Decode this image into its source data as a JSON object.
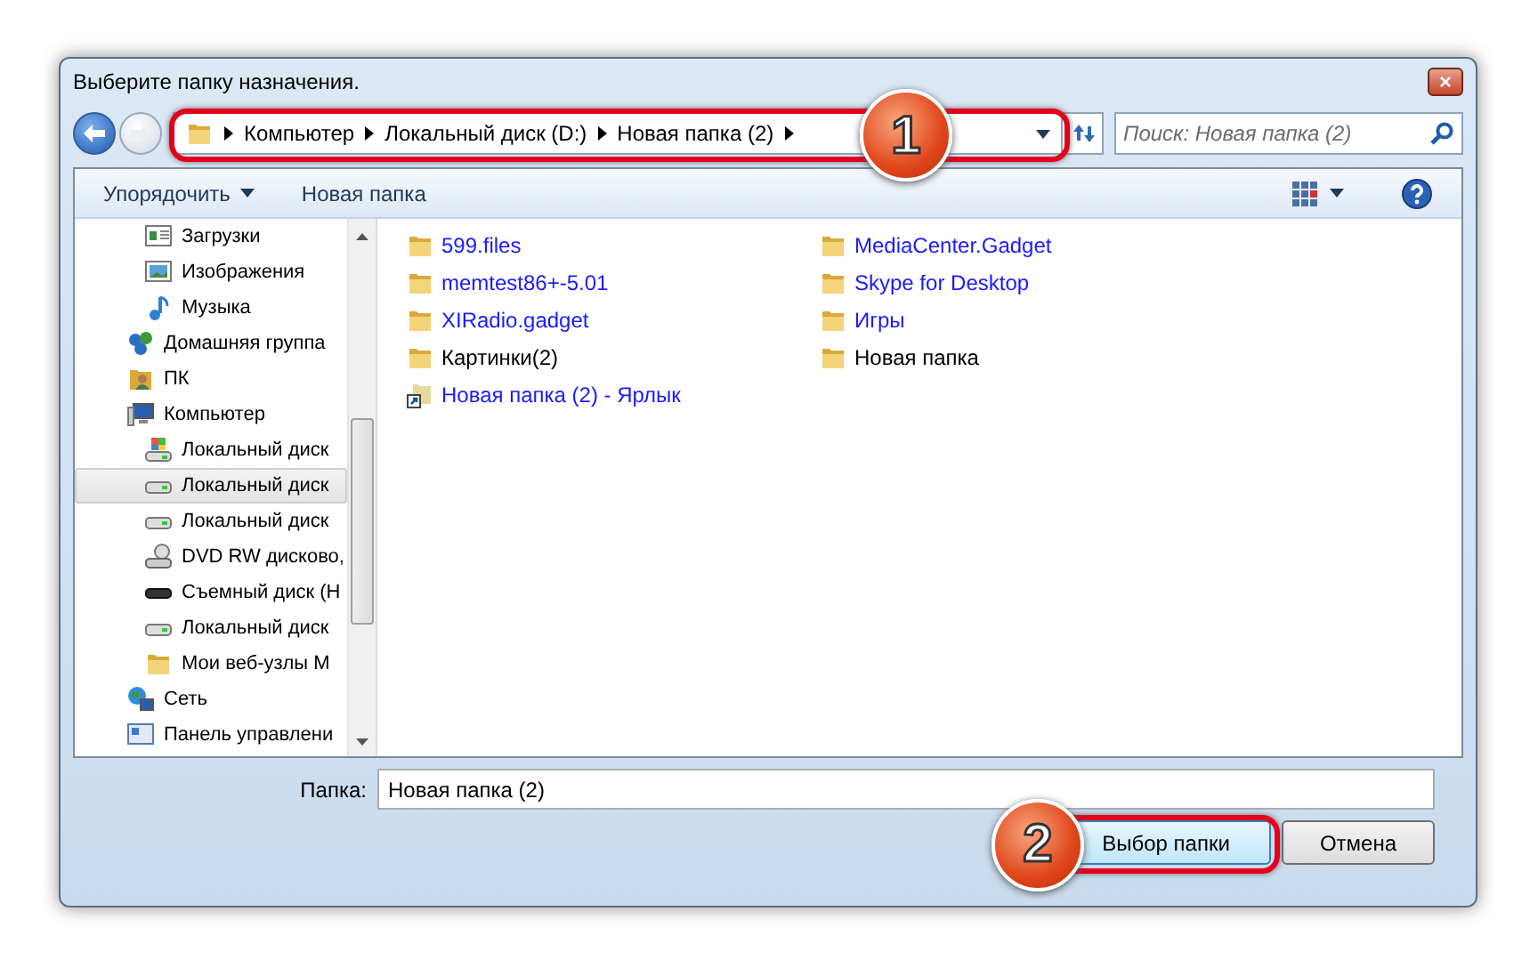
{
  "window": {
    "title": "Выберите папку назначения.",
    "close_label": "×"
  },
  "address": {
    "segments": [
      "Компьютер",
      "Локальный диск (D:)",
      "Новая папка (2)"
    ],
    "callout": "1"
  },
  "search": {
    "placeholder": "Поиск: Новая папка (2)"
  },
  "toolbar": {
    "organize": "Упорядочить",
    "new_folder": "Новая папка"
  },
  "sidebar": {
    "continued_children": [
      {
        "label": "Загрузки",
        "kind": "downloads",
        "selected": false
      },
      {
        "label": "Изображения",
        "kind": "pictures",
        "selected": false
      },
      {
        "label": "Музыка",
        "kind": "music",
        "selected": false
      }
    ],
    "items": [
      {
        "label": "Домашняя группа",
        "kind": "homegroup",
        "selected": false
      },
      {
        "label": "ПК",
        "kind": "userfolder",
        "selected": false
      },
      {
        "label": "Компьютер",
        "kind": "computer",
        "selected": false,
        "children": [
          {
            "label": "Локальный диск",
            "kind": "sysdisk",
            "selected": false
          },
          {
            "label": "Локальный диск",
            "kind": "disk",
            "selected": true
          },
          {
            "label": "Локальный диск",
            "kind": "disk",
            "selected": false
          },
          {
            "label": "DVD RW дисково,",
            "kind": "dvd",
            "selected": false
          },
          {
            "label": "Съемный диск (Н",
            "kind": "removable",
            "selected": false
          },
          {
            "label": "Локальный диск",
            "kind": "disk",
            "selected": false
          },
          {
            "label": "Мои веб-узлы М",
            "kind": "folder",
            "selected": false
          }
        ]
      },
      {
        "label": "Сеть",
        "kind": "network",
        "selected": false
      },
      {
        "label": "Панель управлени",
        "kind": "controlpanel",
        "selected": false
      }
    ]
  },
  "files": [
    {
      "name": "599.files",
      "kind": "folder",
      "compressed": true
    },
    {
      "name": "memtest86+-5.01",
      "kind": "folder",
      "compressed": true
    },
    {
      "name": "XIRadio.gadget",
      "kind": "folder",
      "compressed": true
    },
    {
      "name": "Картинки(2)",
      "kind": "folder",
      "compressed": false
    },
    {
      "name": "Новая папка (2) - Ярлык",
      "kind": "shortcut",
      "compressed": true
    },
    {
      "name": "MediaCenter.Gadget",
      "kind": "folder",
      "compressed": true
    },
    {
      "name": "Skype for Desktop",
      "kind": "folder",
      "compressed": true
    },
    {
      "name": "Игры",
      "kind": "folder",
      "compressed": true
    },
    {
      "name": "Новая папка",
      "kind": "folder",
      "compressed": false
    }
  ],
  "folder_field": {
    "label": "Папка:",
    "value": "Новая папка (2)"
  },
  "buttons": [
    {
      "label": "Выбор папки",
      "primary": true,
      "callout": "2"
    },
    {
      "label": "Отмена",
      "primary": false
    }
  ]
}
